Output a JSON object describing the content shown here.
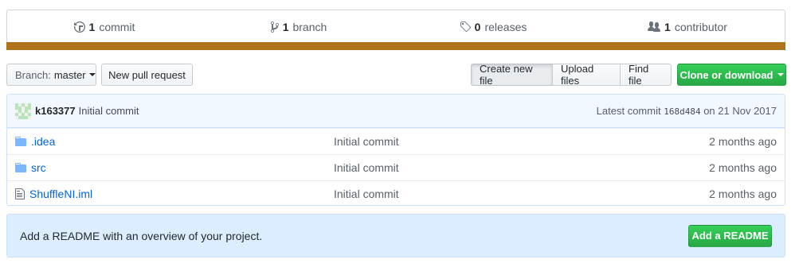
{
  "summary": {
    "commits": {
      "count": "1",
      "label": "commit",
      "icon": "history-icon"
    },
    "branches": {
      "count": "1",
      "label": "branch",
      "icon": "branch-icon"
    },
    "releases": {
      "count": "0",
      "label": "releases",
      "icon": "tag-icon"
    },
    "contributors": {
      "count": "1",
      "label": "contributor",
      "icon": "people-icon"
    },
    "language_color": "#b07219"
  },
  "toolbar": {
    "branch_prefix": "Branch:",
    "branch_name": "master",
    "new_pr": "New pull request",
    "create_file": "Create new file",
    "upload_files": "Upload files",
    "find_file": "Find file",
    "clone": "Clone or download"
  },
  "commit": {
    "author": "k163377",
    "message": "Initial commit",
    "latest_prefix": "Latest commit",
    "sha": "168d484",
    "date_text": "on 21 Nov 2017"
  },
  "files": [
    {
      "type": "directory",
      "icon": "folder-icon",
      "name": ".idea",
      "message": "Initial commit",
      "age": "2 months ago"
    },
    {
      "type": "directory",
      "icon": "folder-icon",
      "name": "src",
      "message": "Initial commit",
      "age": "2 months ago"
    },
    {
      "type": "file",
      "icon": "file-icon",
      "name": "ShuffleNI.iml",
      "message": "Initial commit",
      "age": "2 months ago"
    }
  ],
  "readme": {
    "prompt": "Add a README with an overview of your project.",
    "button": "Add a README"
  },
  "colors": {
    "link": "#0366d6",
    "primary_button": "#28a745",
    "commit_bar": "#f1f8ff",
    "readme_bar": "#dbedff"
  }
}
